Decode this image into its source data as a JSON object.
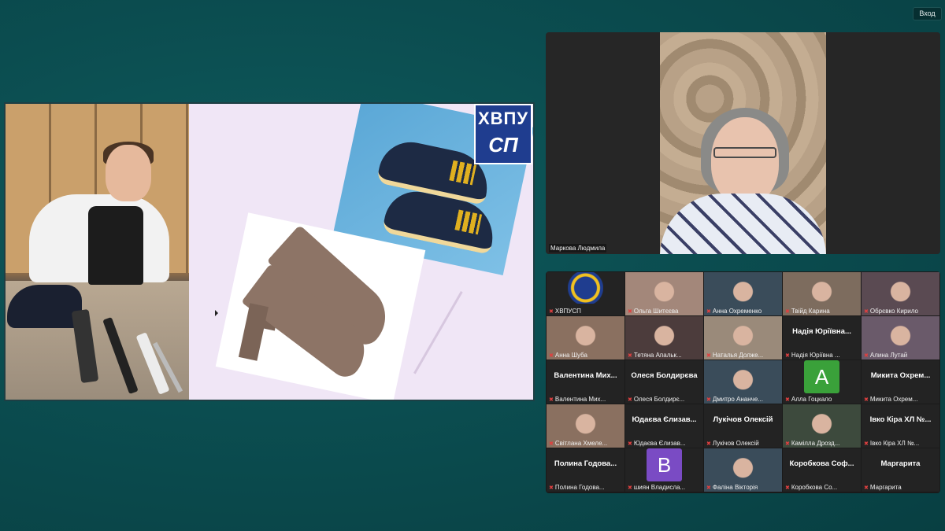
{
  "header": {
    "login_label": "Вход"
  },
  "presentation": {
    "logo_line1": "ХВПУ",
    "logo_line2": "СП"
  },
  "speaker": {
    "name": "Маркова Людмила"
  },
  "colors": {
    "background": "#0b4d50",
    "muted_mic": "#e04040",
    "avatar_green": "#3aa13a",
    "avatar_purple": "#7a4bc4"
  },
  "participants": [
    {
      "big": "",
      "label": "ХВПУСП",
      "thumb": "logo"
    },
    {
      "big": "",
      "label": "Ольга Шитєєва",
      "thumb": "photo"
    },
    {
      "big": "",
      "label": "Анна Охременко",
      "thumb": "photo"
    },
    {
      "big": "",
      "label": "Твійд Карина",
      "thumb": "photo"
    },
    {
      "big": "",
      "label": "Обрєвко Кирило",
      "thumb": "photo"
    },
    {
      "big": "",
      "label": "Анна Шуба",
      "thumb": "photo"
    },
    {
      "big": "",
      "label": "Тетяна Апальк...",
      "thumb": "photo"
    },
    {
      "big": "",
      "label": "Наталья Долже...",
      "thumb": "photo"
    },
    {
      "big": "Надія Юріївна...",
      "label": "Надія Юріївна ...",
      "thumb": "none"
    },
    {
      "big": "",
      "label": "Алина Лутай",
      "thumb": "photo"
    },
    {
      "big": "Валентина Мих...",
      "label": "Валентина Мих...",
      "thumb": "none"
    },
    {
      "big": "Олеся Болдирєва",
      "label": "Олеся Болдирє...",
      "thumb": "none"
    },
    {
      "big": "",
      "label": "Дмитро Ананче...",
      "thumb": "photo"
    },
    {
      "big": "",
      "label": "Алла Гоцкало",
      "thumb": "letter",
      "letter": "A"
    },
    {
      "big": "Микита Охрем...",
      "label": "Микита Охрем...",
      "thumb": "none"
    },
    {
      "big": "",
      "label": "Світлана Хмеле...",
      "thumb": "photo"
    },
    {
      "big": "Юдаєва Єлизав...",
      "label": "Юдаєва Єлизав...",
      "thumb": "none"
    },
    {
      "big": "Лукічов Олексій",
      "label": "Лукічов Олексій",
      "thumb": "none"
    },
    {
      "big": "",
      "label": "Камілла Дрозд...",
      "thumb": "photo"
    },
    {
      "big": "Івко Кіра ХЛ №...",
      "label": "Івко Кіра ХЛ №...",
      "thumb": "none"
    },
    {
      "big": "Полина Годова...",
      "label": "Полина Годова...",
      "thumb": "none"
    },
    {
      "big": "",
      "label": "шиян Владисла...",
      "thumb": "letter",
      "letter": "B"
    },
    {
      "big": "",
      "label": "Фаліна Вікторія",
      "thumb": "photo"
    },
    {
      "big": "Коробкова Соф...",
      "label": "Коробкова Со...",
      "thumb": "none"
    },
    {
      "big": "Маргарита",
      "label": "Маргарита",
      "thumb": "none"
    }
  ]
}
